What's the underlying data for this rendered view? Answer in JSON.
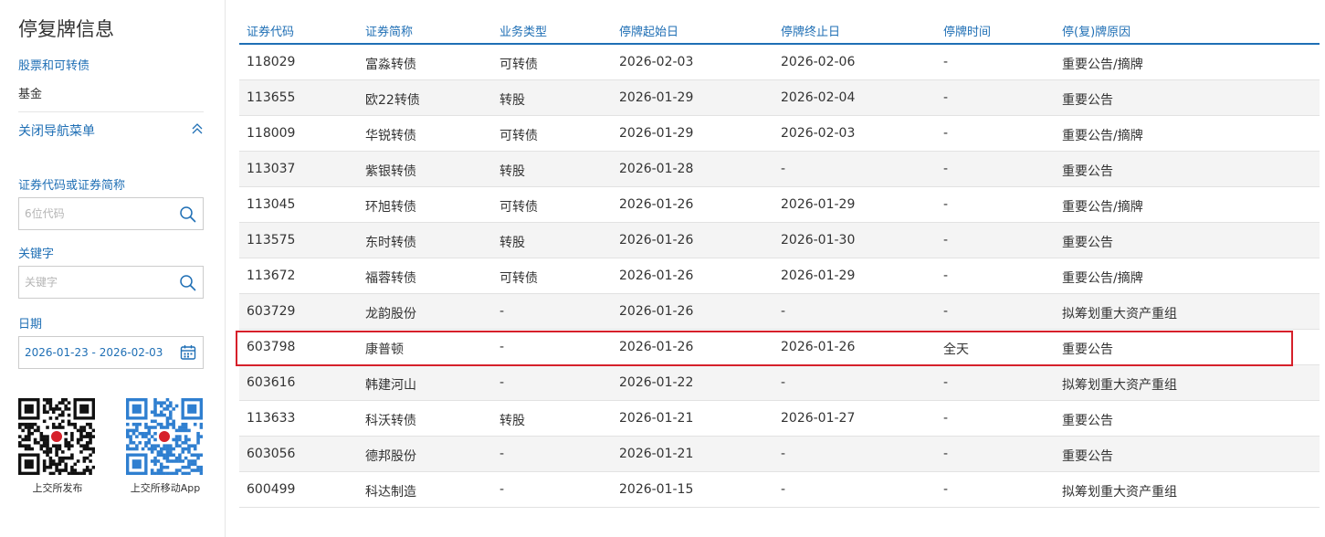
{
  "sidebar": {
    "title": "停复牌信息",
    "nav": [
      {
        "label": "股票和可转债"
      },
      {
        "label": "基金"
      }
    ],
    "collapse_label": "关闭导航菜单",
    "code_field": {
      "label": "证券代码或证券简称",
      "placeholder": "6位代码"
    },
    "keyword_field": {
      "label": "关键字",
      "placeholder": "关键字"
    },
    "date_field": {
      "label": "日期",
      "value": "2026-01-23 - 2026-02-03"
    },
    "qr_codes": [
      {
        "caption": "上交所发布"
      },
      {
        "caption": "上交所移动App"
      }
    ]
  },
  "table": {
    "headers": [
      "证券代码",
      "证券简称",
      "业务类型",
      "停牌起始日",
      "停牌终止日",
      "停牌时间",
      "停(复)牌原因"
    ],
    "rows": [
      {
        "code": "118029",
        "name": "富淼转债",
        "type": "可转债",
        "start": "2026-02-03",
        "end": "2026-02-06",
        "time": "-",
        "reason": "重要公告/摘牌"
      },
      {
        "code": "113655",
        "name": "欧22转债",
        "type": "转股",
        "start": "2026-01-29",
        "end": "2026-02-04",
        "time": "-",
        "reason": "重要公告"
      },
      {
        "code": "118009",
        "name": "华锐转债",
        "type": "可转债",
        "start": "2026-01-29",
        "end": "2026-02-03",
        "time": "-",
        "reason": "重要公告/摘牌"
      },
      {
        "code": "113037",
        "name": "紫银转债",
        "type": "转股",
        "start": "2026-01-28",
        "end": "-",
        "time": "-",
        "reason": "重要公告"
      },
      {
        "code": "113045",
        "name": "环旭转债",
        "type": "可转债",
        "start": "2026-01-26",
        "end": "2026-01-29",
        "time": "-",
        "reason": "重要公告/摘牌"
      },
      {
        "code": "113575",
        "name": "东时转债",
        "type": "转股",
        "start": "2026-01-26",
        "end": "2026-01-30",
        "time": "-",
        "reason": "重要公告"
      },
      {
        "code": "113672",
        "name": "福蓉转债",
        "type": "可转债",
        "start": "2026-01-26",
        "end": "2026-01-29",
        "time": "-",
        "reason": "重要公告/摘牌"
      },
      {
        "code": "603729",
        "name": "龙韵股份",
        "type": "-",
        "start": "2026-01-26",
        "end": "-",
        "time": "-",
        "reason": "拟筹划重大资产重组"
      },
      {
        "code": "603798",
        "name": "康普顿",
        "type": "-",
        "start": "2026-01-26",
        "end": "2026-01-26",
        "time": "全天",
        "reason": "重要公告"
      },
      {
        "code": "603616",
        "name": "韩建河山",
        "type": "-",
        "start": "2026-01-22",
        "end": "-",
        "time": "-",
        "reason": "拟筹划重大资产重组"
      },
      {
        "code": "113633",
        "name": "科沃转债",
        "type": "转股",
        "start": "2026-01-21",
        "end": "2026-01-27",
        "time": "-",
        "reason": "重要公告"
      },
      {
        "code": "603056",
        "name": "德邦股份",
        "type": "-",
        "start": "2026-01-21",
        "end": "-",
        "time": "-",
        "reason": "重要公告"
      },
      {
        "code": "600499",
        "name": "科达制造",
        "type": "-",
        "start": "2026-01-15",
        "end": "-",
        "time": "-",
        "reason": "拟筹划重大资产重组"
      }
    ],
    "highlighted_code": "603798"
  },
  "colors": {
    "accent": "#1f6fb5",
    "highlight_border": "#d6202a",
    "stripe": "#f4f4f4"
  },
  "icons": {
    "collapse": "chevron-double-up-icon",
    "search": "search-icon",
    "date": "calendar-icon"
  }
}
